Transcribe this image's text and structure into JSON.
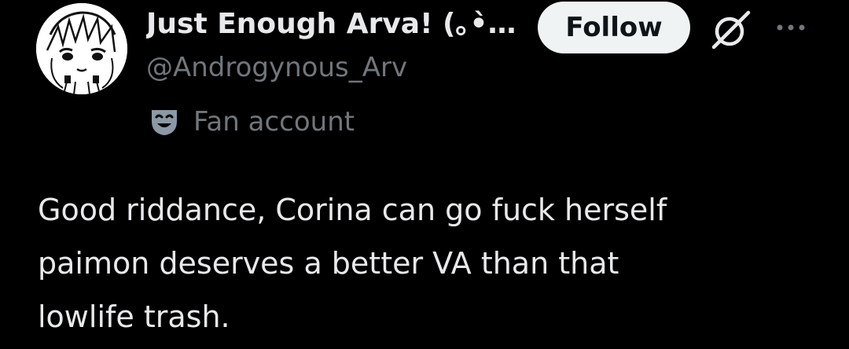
{
  "author": {
    "display_name": "Just Enough Arva! (｡•̀…",
    "handle": "@Androgynous_Arv",
    "avatar": "avatar-anime-sketch"
  },
  "actions": {
    "follow_label": "Follow",
    "grok_icon": "grok-slashed-circle-icon",
    "more_icon": "more-horizontal-icon"
  },
  "badge": {
    "icon": "theater-mask-icon",
    "label": "Fan account"
  },
  "tweet": {
    "lines": [
      "Good riddance, Corina can go fuck herself",
      "paimon deserves a better VA than that",
      "lowlife trash."
    ]
  },
  "colors": {
    "background": "#000000",
    "primary_text": "#e7e9ea",
    "secondary_text": "#71767b",
    "follow_bg": "#eff3f4",
    "follow_text": "#0f1419",
    "mask_icon": "#8b98a5"
  }
}
